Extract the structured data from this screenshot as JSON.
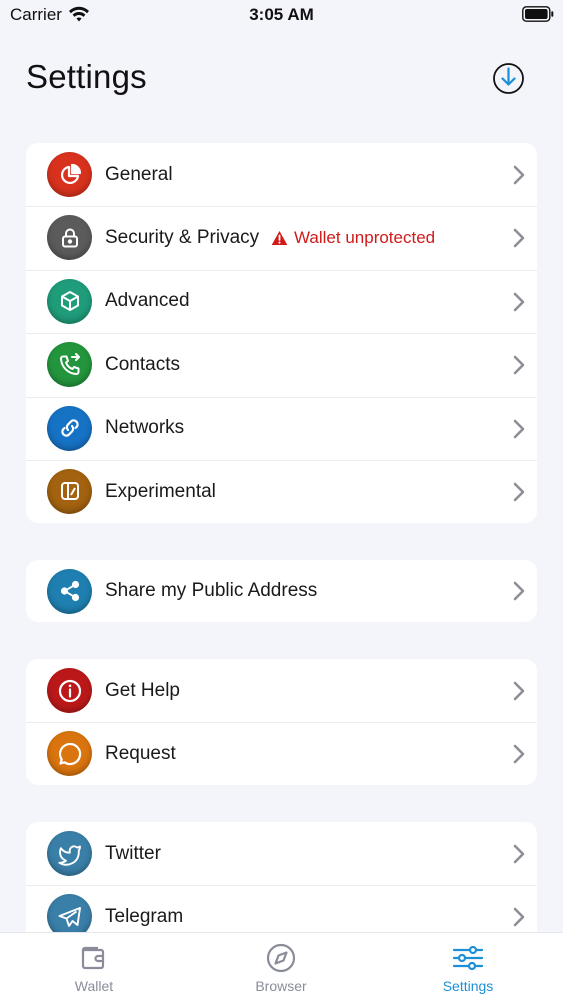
{
  "status_bar": {
    "carrier": "Carrier",
    "time": "3:05 AM"
  },
  "header": {
    "title": "Settings"
  },
  "groups": [
    {
      "items": [
        {
          "label": "General",
          "icon": "pie-chart-icon",
          "color": "#d8321e"
        },
        {
          "label": "Security & Privacy",
          "icon": "lock-icon",
          "color": "#5b5b5b",
          "warning": "Wallet unprotected"
        },
        {
          "label": "Advanced",
          "icon": "cube-icon",
          "color": "#1f9c7a"
        },
        {
          "label": "Contacts",
          "icon": "phone-icon",
          "color": "#23953d"
        },
        {
          "label": "Networks",
          "icon": "link-icon",
          "color": "#1672c4"
        },
        {
          "label": "Experimental",
          "icon": "flask-icon",
          "color": "#a2620f"
        }
      ]
    },
    {
      "items": [
        {
          "label": "Share my Public Address",
          "icon": "share-icon",
          "color": "#1f7fb0"
        }
      ]
    },
    {
      "items": [
        {
          "label": "Get Help",
          "icon": "info-icon",
          "color": "#bb1919"
        },
        {
          "label": "Request",
          "icon": "chat-bubble-icon",
          "color": "#d9740e"
        }
      ]
    },
    {
      "items": [
        {
          "label": "Twitter",
          "icon": "twitter-icon",
          "color": "#3a7fa8"
        },
        {
          "label": "Telegram",
          "icon": "telegram-icon",
          "color": "#3a7fa8"
        }
      ]
    }
  ],
  "tab_bar": {
    "tabs": [
      {
        "label": "Wallet",
        "icon": "wallet-icon",
        "active": false
      },
      {
        "label": "Browser",
        "icon": "compass-icon",
        "active": false
      },
      {
        "label": "Settings",
        "icon": "sliders-icon",
        "active": true
      }
    ],
    "active_color": "#1d8fd6",
    "inactive_color": "#8a8d99"
  },
  "colors": {
    "warning": "#d11a1a",
    "chevron": "#8e8e96",
    "accent": "#1d8fd6"
  }
}
